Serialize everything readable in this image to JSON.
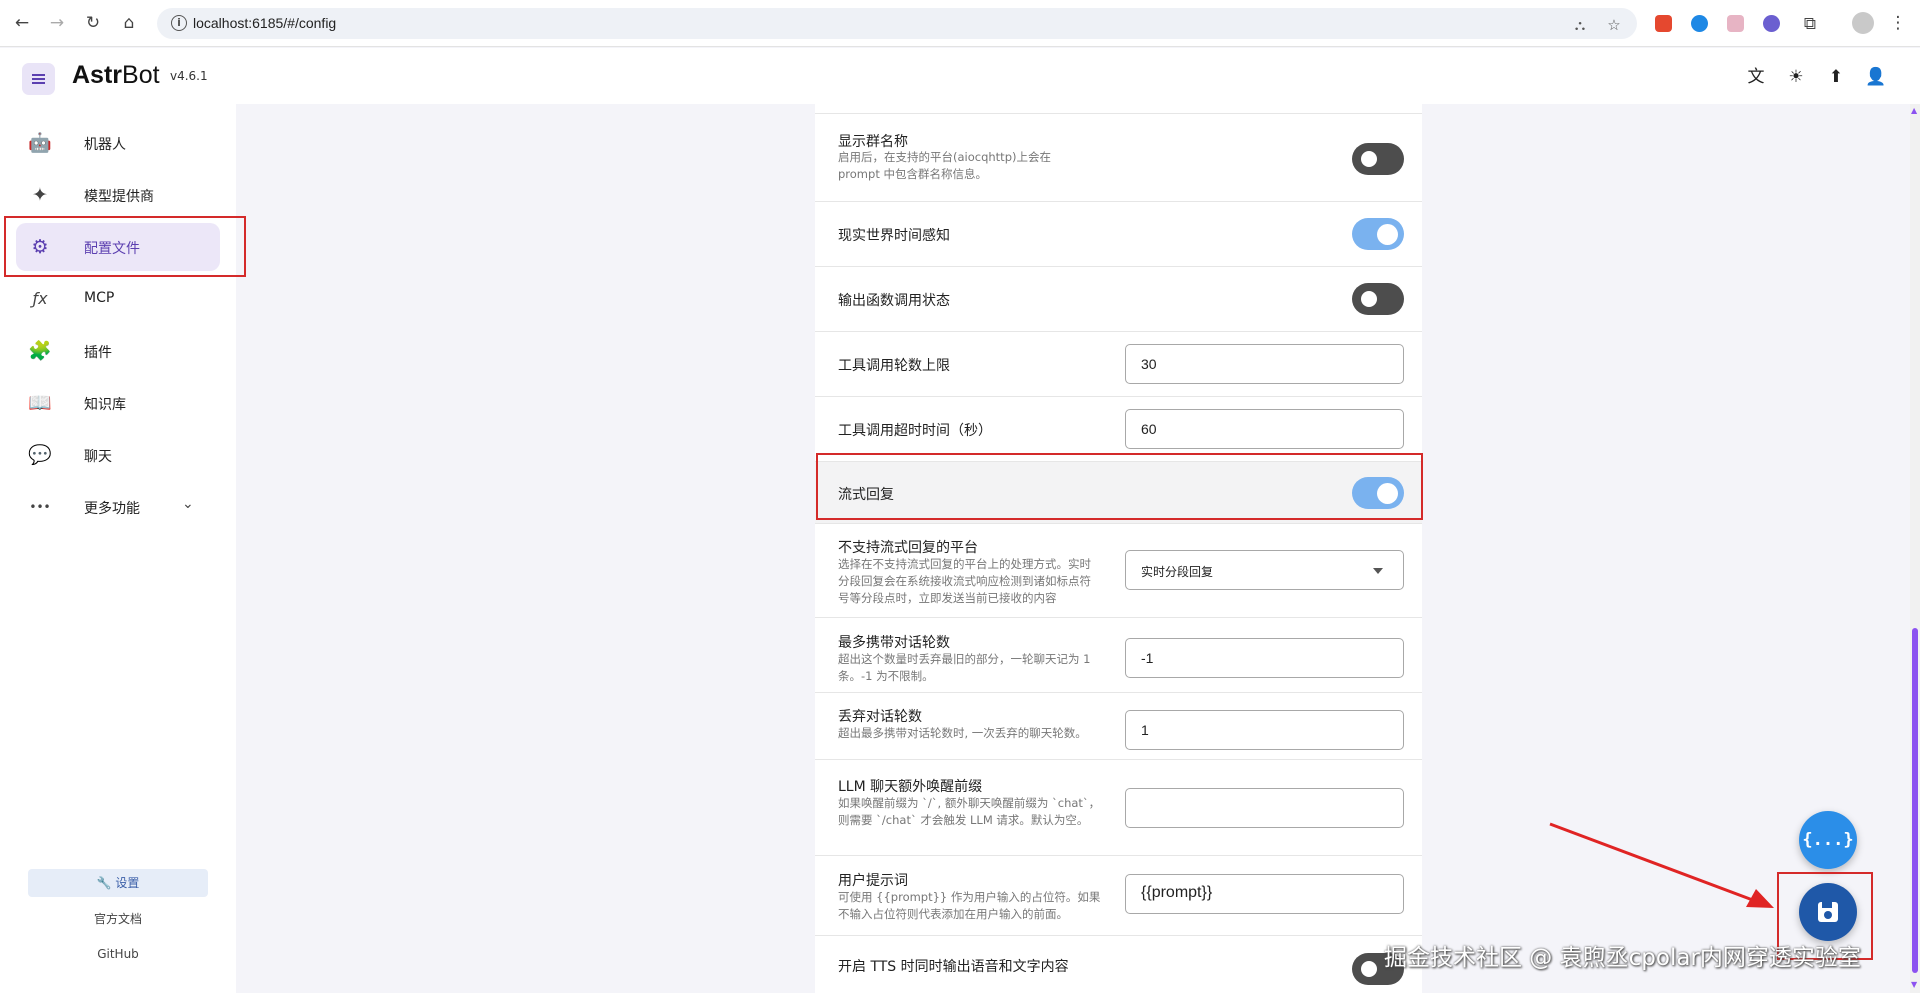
{
  "browser": {
    "url": "localhost:6185/#/config",
    "extension_colors": [
      "#e5482f",
      "#1e88e5",
      "#e7b4c4",
      "#6b5fd0"
    ]
  },
  "header": {
    "brand_prefix": "Astr",
    "brand_suffix": "Bot",
    "version": "v4.6.1",
    "icons": [
      "translate-icon",
      "theme-brightness-icon",
      "upload-icon",
      "account-icon"
    ]
  },
  "sidebar": {
    "items": [
      {
        "label": "机器人",
        "icon": "robot-icon",
        "glyph": "🤖"
      },
      {
        "label": "模型提供商",
        "icon": "sparkles-icon",
        "glyph": "✦"
      },
      {
        "label": "配置文件",
        "icon": "gear-icon",
        "glyph": "⚙",
        "active": true
      },
      {
        "label": "MCP",
        "icon": "function-icon",
        "glyph": "ƒx"
      },
      {
        "label": "插件",
        "icon": "puzzle-icon",
        "glyph": "🧩"
      },
      {
        "label": "知识库",
        "icon": "book-icon",
        "glyph": "📖"
      },
      {
        "label": "聊天",
        "icon": "chat-bubble-icon",
        "glyph": "💬"
      },
      {
        "label": "更多功能",
        "icon": "more-icon",
        "glyph": "•••"
      }
    ],
    "settings_label": "🔧 设置",
    "docs_label": "官方文档",
    "github_label": "GitHub"
  },
  "config": {
    "show_group_name": {
      "title": "显示群名称",
      "desc": "启用后，在支持的平台(aiocqhttp)上会在 prompt 中包含群名称信息。",
      "enabled": false
    },
    "realtime_awareness": {
      "title": "现实世界时间感知",
      "enabled": true
    },
    "output_function_call_status": {
      "title": "输出函数调用状态",
      "enabled": false
    },
    "tool_call_max_rounds": {
      "title": "工具调用轮数上限",
      "value": "30"
    },
    "tool_call_timeout": {
      "title": "工具调用超时时间（秒）",
      "value": "60"
    },
    "streaming_reply": {
      "title": "流式回复",
      "enabled": true
    },
    "unsupported_stream_platform": {
      "title": "不支持流式回复的平台",
      "desc": "选择在不支持流式回复的平台上的处理方式。实时分段回复会在系统接收流式响应检测到诸如标点符号等分段点时，立即发送当前已接收的内容",
      "selected": "实时分段回复"
    },
    "max_context_rounds": {
      "title": "最多携带对话轮数",
      "desc": "超出这个数量时丢弃最旧的部分，一轮聊天记为 1 条。-1 为不限制。",
      "value": "-1"
    },
    "discard_rounds": {
      "title": "丢弃对话轮数",
      "desc": "超出最多携带对话轮数时, 一次丢弃的聊天轮数。",
      "value": "1"
    },
    "llm_wake_prefix": {
      "title": "LLM 聊天额外唤醒前缀",
      "desc": "如果唤醒前缀为 `/`, 额外聊天唤醒前缀为 `chat`，则需要 `/chat` 才会触发 LLM 请求。默认为空。",
      "value": ""
    },
    "user_prompt": {
      "title": "用户提示词",
      "desc": "可使用 {{prompt}} 作为用户输入的占位符。如果不输入占位符则代表添加在用户输入的前面。",
      "value": "{{prompt}}"
    },
    "tts_output_both": {
      "title": "开启 TTS 时同时输出语音和文字内容",
      "enabled": false
    }
  },
  "fab": {
    "json_label": "{...}"
  },
  "watermark": "掘金技术社区 @ 袁煦丞cpolar内网穿透实验室"
}
